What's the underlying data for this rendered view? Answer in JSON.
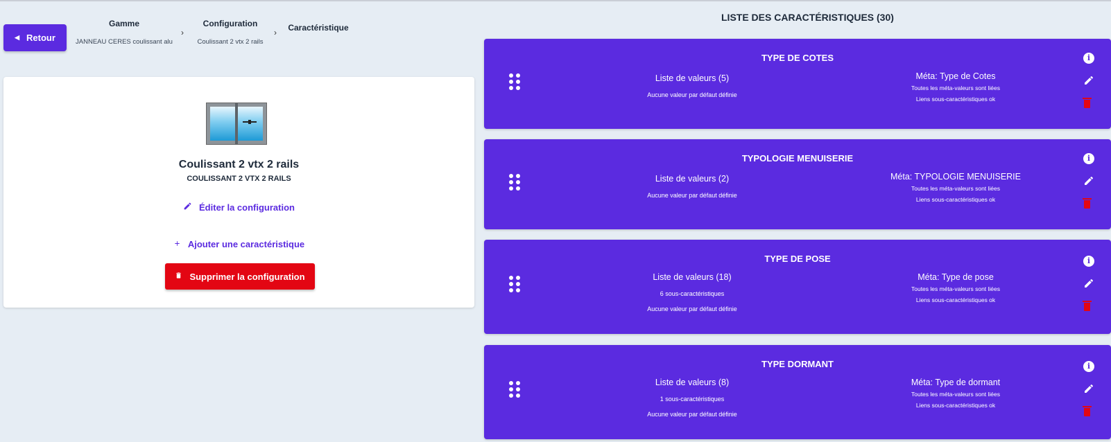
{
  "header": {
    "back_label": "Retour",
    "breadcrumb": [
      {
        "title": "Gamme",
        "subtitle": "JANNEAU CERES coulissant alu"
      },
      {
        "title": "Configuration",
        "subtitle": "Coulissant 2 vtx 2 rails"
      },
      {
        "title": "Caractéristique",
        "subtitle": ""
      }
    ]
  },
  "config": {
    "name": "Coulissant 2 vtx 2 rails",
    "code": "COULISSANT 2 VTX 2 RAILS",
    "edit_label": "Éditer la configuration",
    "add_label": "Ajouter une caractéristique",
    "delete_label": "Supprimer la configuration"
  },
  "features": {
    "title": "LISTE DES CARACTÉRISTIQUES (30)",
    "items": [
      {
        "title": "TYPE DE COTES",
        "values": "Liste de valeurs (5)",
        "sub": "",
        "default": "Aucune valeur par défaut définie",
        "meta": "Méta: Type de Cotes",
        "meta_status": "Toutes les méta-valeurs sont liées",
        "links_status": "Liens sous-caractéristiques ok"
      },
      {
        "title": "TYPOLOGIE MENUISERIE",
        "values": "Liste de valeurs (2)",
        "sub": "",
        "default": "Aucune valeur par défaut définie",
        "meta": "Méta: TYPOLOGIE MENUISERIE",
        "meta_status": "Toutes les méta-valeurs sont liées",
        "links_status": "Liens sous-caractéristiques ok"
      },
      {
        "title": "TYPE DE POSE",
        "values": "Liste de valeurs (18)",
        "sub": "6 sous-caractéristiques",
        "default": "Aucune valeur par défaut définie",
        "meta": "Méta: Type de pose",
        "meta_status": "Toutes les méta-valeurs sont liées",
        "links_status": "Liens sous-caractéristiques ok"
      },
      {
        "title": "TYPE DORMANT",
        "values": "Liste de valeurs (8)",
        "sub": "1 sous-caractéristiques",
        "default": "Aucune valeur par défaut définie",
        "meta": "Méta: Type de dormant",
        "meta_status": "Toutes les méta-valeurs sont liées",
        "links_status": "Liens sous-caractéristiques ok"
      }
    ]
  },
  "colors": {
    "accent": "#5b2be0",
    "danger": "#e30613",
    "background": "#e6edf4"
  },
  "icons": {
    "back": "chevron-left-icon",
    "separator": "chevron-right-icon",
    "edit": "pencil-icon",
    "add": "plus-icon",
    "delete": "trash-icon",
    "drag": "drag-handle-icon",
    "info": "info-icon"
  }
}
